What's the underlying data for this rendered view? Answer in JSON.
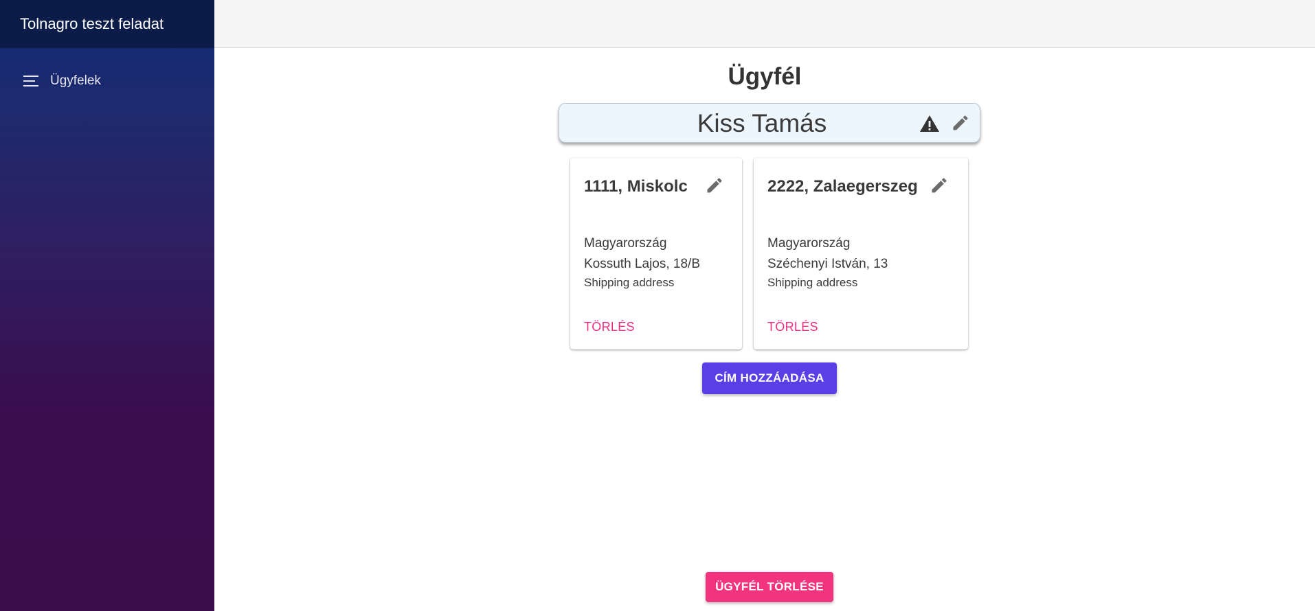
{
  "app": {
    "title": "Tolnagro teszt feladat"
  },
  "sidebar": {
    "items": [
      {
        "label": "Ügyfelek",
        "icon": "menu-lines-icon"
      }
    ]
  },
  "page": {
    "title": "Ügyfél"
  },
  "customer": {
    "name": "Kiss Tamás",
    "status_icon": "warning-icon",
    "edit_icon": "pencil-icon"
  },
  "addresses": [
    {
      "title": "1111, Miskolc",
      "country": "Magyarország",
      "street": "Kossuth Lajos, 18/B",
      "type": "Shipping address",
      "delete_label": "TÖRLÉS"
    },
    {
      "title": "2222, Zalaegerszeg",
      "country": "Magyarország",
      "street": "Széchenyi István, 13",
      "type": "Shipping address",
      "delete_label": "TÖRLÉS"
    }
  ],
  "actions": {
    "add_address_label": "CÍM HOZZÁADÁSA",
    "delete_customer_label": "ÜGYFÉL TÖRLÉSE"
  },
  "colors": {
    "primary_button": "#5a3fe6",
    "danger": "#f2347e",
    "sidebar_header": "#0c1c48"
  }
}
